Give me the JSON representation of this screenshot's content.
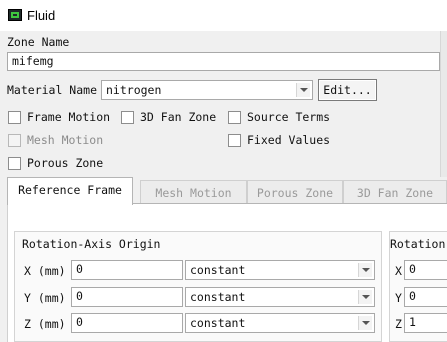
{
  "window": {
    "title": "Fluid",
    "icon": "fluent-app-icon"
  },
  "zone_name": {
    "label": "Zone Name",
    "value": "mifemg"
  },
  "material": {
    "label": "Material Name",
    "value": "nitrogen",
    "edit_label": "Edit..."
  },
  "options": {
    "frame_motion": {
      "label": "Frame Motion",
      "checked": false
    },
    "fan_zone": {
      "label": "3D Fan Zone",
      "checked": false
    },
    "source_terms": {
      "label": "Source Terms",
      "checked": false
    },
    "mesh_motion": {
      "label": "Mesh Motion",
      "checked": false,
      "disabled": true
    },
    "fixed_values": {
      "label": "Fixed Values",
      "checked": false
    },
    "porous_zone": {
      "label": "Porous Zone",
      "checked": false
    }
  },
  "tabs": [
    {
      "label": "Reference Frame",
      "active": true
    },
    {
      "label": "Mesh Motion",
      "active": false
    },
    {
      "label": "Porous Zone",
      "active": false
    },
    {
      "label": "3D Fan Zone",
      "active": false
    }
  ],
  "origin": {
    "title": "Rotation-Axis Origin",
    "rows": [
      {
        "label": "X (mm)",
        "value": "0",
        "method": "constant"
      },
      {
        "label": "Y (mm)",
        "value": "0",
        "method": "constant"
      },
      {
        "label": "Z (mm)",
        "value": "0",
        "method": "constant"
      }
    ]
  },
  "direction": {
    "title": "Rotation",
    "rows": [
      {
        "label": "X",
        "value": "0"
      },
      {
        "label": "Y",
        "value": "0"
      },
      {
        "label": "Z",
        "value": "1"
      }
    ]
  }
}
